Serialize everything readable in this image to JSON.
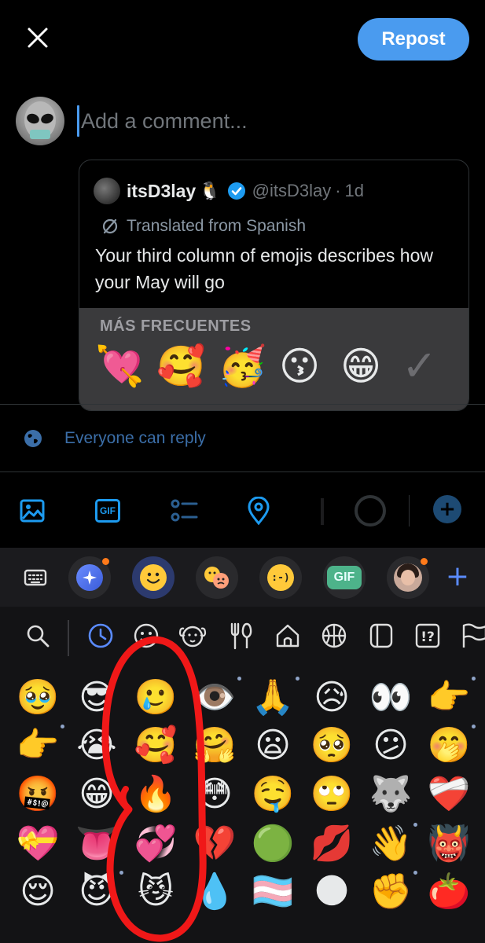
{
  "compose": {
    "repost_label": "Repost",
    "comment_placeholder": "Add a comment..."
  },
  "quote": {
    "author_name": "itsD3lay",
    "author_emoji": "🐧",
    "handle": "@itsD3lay",
    "separator": "·",
    "time": "1d",
    "translated_label": "Translated from Spanish",
    "text": "Your third column of emojis describes how your May will go",
    "media": {
      "label": "MÁS FRECUENTES",
      "emojis": [
        "💘",
        "🥰",
        "🥳",
        "😗",
        "😁"
      ],
      "check": "✓"
    }
  },
  "reply_settings": {
    "label": "Everyone can reply"
  },
  "toolbar": {
    "gif_label": "GIF",
    "icons": [
      "image-icon",
      "gif-icon",
      "poll-icon",
      "location-icon"
    ],
    "add_label": "+"
  },
  "keyboard": {
    "tools": [
      "keyboard-icon",
      "sparkle-icon",
      "emoji-icon",
      "emoticon-faces-icon",
      "text-emoticon-icon",
      "gif-icon",
      "memoji-icon",
      "plus-icon"
    ],
    "text_emoticon": ":-)",
    "gif_label": "GIF",
    "plus_label": "+",
    "categories": [
      "search-icon",
      "recent-clock-icon",
      "smileys-icon",
      "animals-icon",
      "food-icon",
      "places-icon",
      "activity-icon",
      "objects-icon",
      "symbols-icon",
      "flags-icon"
    ],
    "emoji_rows": [
      [
        "🥹",
        "😎",
        "🥲",
        "👁️",
        "🙏",
        "😥",
        "👀",
        "👉"
      ],
      [
        "👉",
        "😭",
        "🥰",
        "🤗",
        "😦",
        "🥺",
        "😕",
        "🤭"
      ],
      [
        "🤬",
        "😁",
        "🔥",
        "😳",
        "🤤",
        "🙄",
        "🐺",
        "❤️‍🩹"
      ],
      [
        "💝",
        "👅",
        "💞",
        "💔",
        "🟢",
        "💋",
        "👋",
        "👹"
      ],
      [
        "😌",
        "😈",
        "😼",
        "💧",
        "🏳️‍⚧️",
        "🌑",
        "✊",
        "🍅"
      ]
    ]
  },
  "colors": {
    "accent": "#1d9bf0",
    "repost_button": "#4a9bef",
    "annotation_red": "#f01818"
  }
}
